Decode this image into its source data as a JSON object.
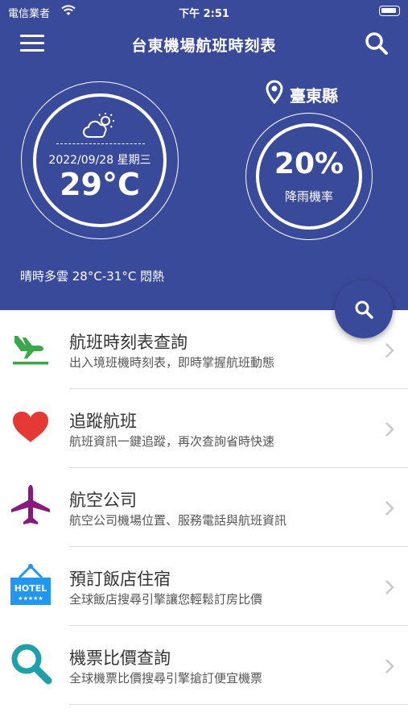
{
  "status_bar": {
    "carrier": "電信業者",
    "time": "下午 2:51"
  },
  "nav": {
    "title": "台東機場航班時刻表"
  },
  "weather": {
    "date": "2022/09/28 星期三",
    "temperature": "29°C",
    "description": "晴時多雲 28°C-31°C 悶熱"
  },
  "location": {
    "name": "臺東縣"
  },
  "rain": {
    "value": "20%",
    "label": "降雨機率"
  },
  "menu": {
    "items": [
      {
        "title": "航班時刻表查詢",
        "subtitle": "出入境班機時刻表，即時掌握航班動態",
        "icon": "plane-landing-icon",
        "color": "#3aa84a"
      },
      {
        "title": "追蹤航班",
        "subtitle": "航班資訊一鍵追蹤，再次查詢省時快速",
        "icon": "heart-icon",
        "color": "#e53935"
      },
      {
        "title": "航空公司",
        "subtitle": "航空公司機場位置、服務電話與航班資訊",
        "icon": "airplane-icon",
        "color": "#8a1a7a"
      },
      {
        "title": "預訂飯店住宿",
        "subtitle": "全球飯店搜尋引擎讓您輕鬆訂房比價",
        "icon": "hotel-sign-icon",
        "color": "#2196f3",
        "sign_text": "HOTEL"
      },
      {
        "title": "機票比價查詢",
        "subtitle": "全球機票比價搜尋引擎搶訂便宜機票",
        "icon": "magnifier-icon",
        "color": "#1fa0a8"
      }
    ]
  },
  "colors": {
    "header_bg": "#3a4a9a"
  }
}
